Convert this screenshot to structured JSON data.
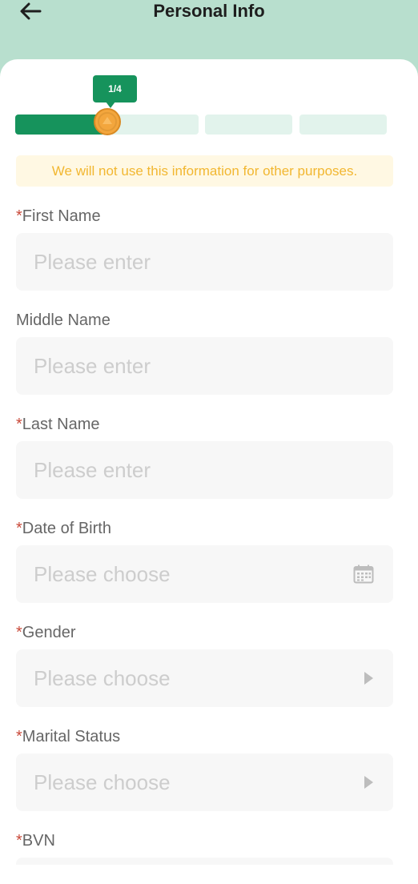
{
  "header": {
    "title": "Personal Info"
  },
  "progress": {
    "step_label": "1/4",
    "current_step": 1,
    "total_steps": 4,
    "first_segment_fill": 0.5
  },
  "notice": {
    "text": "We will not use this information for other purposes."
  },
  "fields": {
    "first_name": {
      "required": true,
      "label": "First Name",
      "placeholder": "Please enter"
    },
    "middle_name": {
      "required": false,
      "label": "Middle Name",
      "placeholder": "Please enter"
    },
    "last_name": {
      "required": true,
      "label": "Last Name",
      "placeholder": "Please enter"
    },
    "date_of_birth": {
      "required": true,
      "label": "Date of Birth",
      "placeholder": "Please choose",
      "icon": "calendar-icon"
    },
    "gender": {
      "required": true,
      "label": "Gender",
      "placeholder": "Please choose",
      "icon": "triangle-right-icon"
    },
    "marital_status": {
      "required": true,
      "label": "Marital Status",
      "placeholder": "Please choose",
      "icon": "triangle-right-icon"
    },
    "bvn": {
      "required": true,
      "label": "BVN"
    }
  },
  "required_mark": "*",
  "colors": {
    "header_bg": "#b8dfce",
    "accent": "#16935c",
    "notice_text": "#f2b731",
    "required": "#c94a3a"
  }
}
